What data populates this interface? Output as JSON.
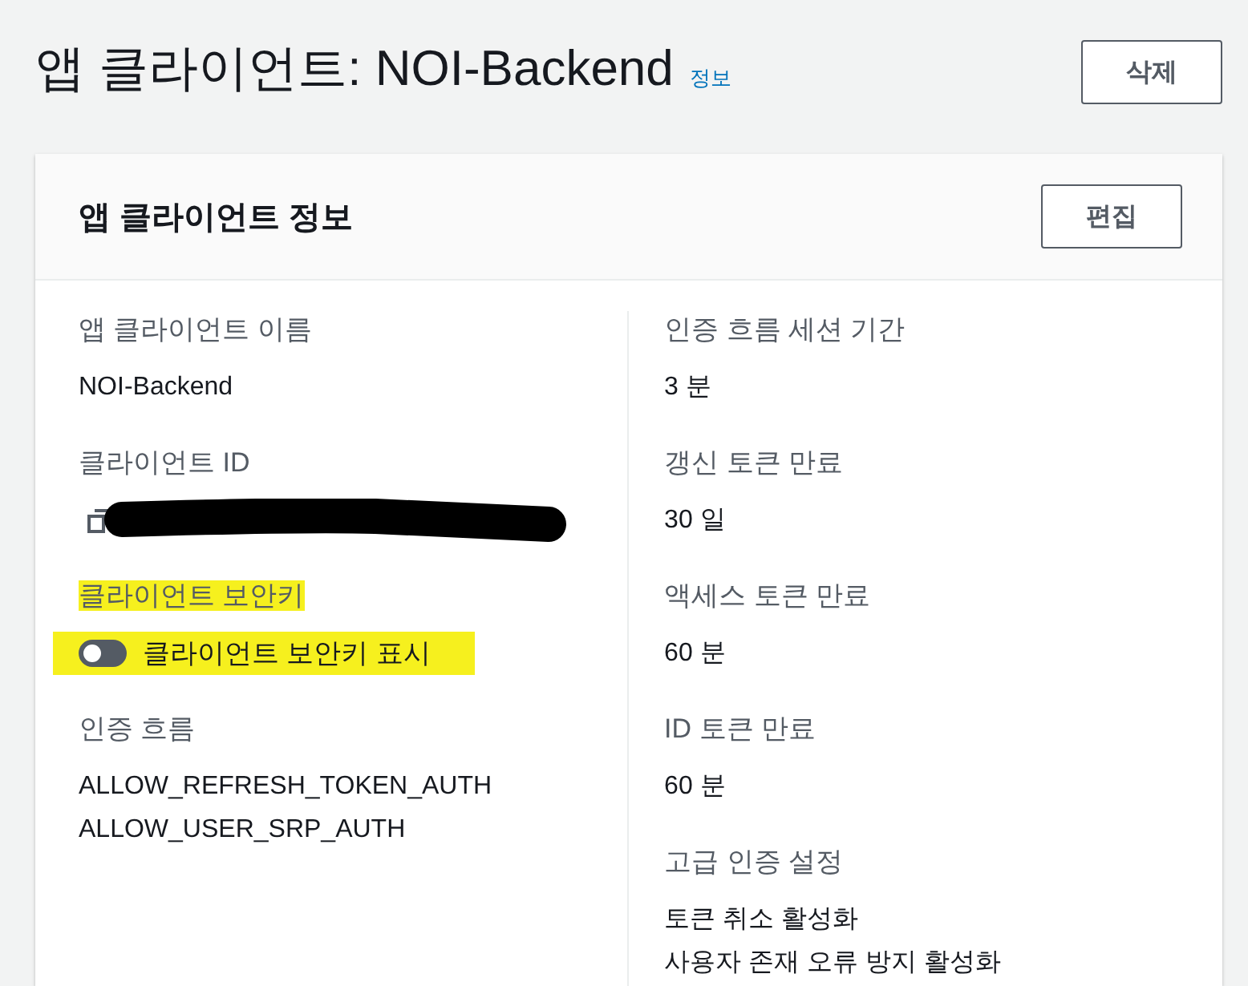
{
  "page": {
    "title": "앱 클라이언트: NOI-Backend",
    "info_link": "정보",
    "delete_button": "삭제"
  },
  "card": {
    "title": "앱 클라이언트 정보",
    "edit_button": "편집",
    "left_fields": [
      {
        "kind": "text",
        "label": "앱 클라이언트 이름",
        "values": [
          "NOI-Backend"
        ],
        "highlighted": false
      },
      {
        "kind": "copy",
        "label": "클라이언트 ID",
        "redacted": true,
        "highlighted": false
      },
      {
        "kind": "toggle",
        "label": "클라이언트 보안키",
        "toggle_label": "클라이언트 보안키 표시",
        "on": false,
        "highlighted": true
      },
      {
        "kind": "text",
        "label": "인증 흐름",
        "values": [
          "ALLOW_REFRESH_TOKEN_AUTH",
          "ALLOW_USER_SRP_AUTH"
        ],
        "highlighted": false
      }
    ],
    "right_fields": [
      {
        "kind": "text",
        "label": "인증 흐름 세션 기간",
        "values": [
          "3 분"
        ],
        "highlighted": false
      },
      {
        "kind": "text",
        "label": "갱신 토큰 만료",
        "values": [
          "30 일"
        ],
        "highlighted": false
      },
      {
        "kind": "text",
        "label": "액세스 토큰 만료",
        "values": [
          "60 분"
        ],
        "highlighted": false
      },
      {
        "kind": "text",
        "label": "ID 토큰 만료",
        "values": [
          "60 분"
        ],
        "highlighted": false
      },
      {
        "kind": "text",
        "label": "고급 인증 설정",
        "values": [
          "토큰 취소 활성화",
          "사용자 존재 오류 방지 활성화"
        ],
        "highlighted": false
      }
    ]
  }
}
